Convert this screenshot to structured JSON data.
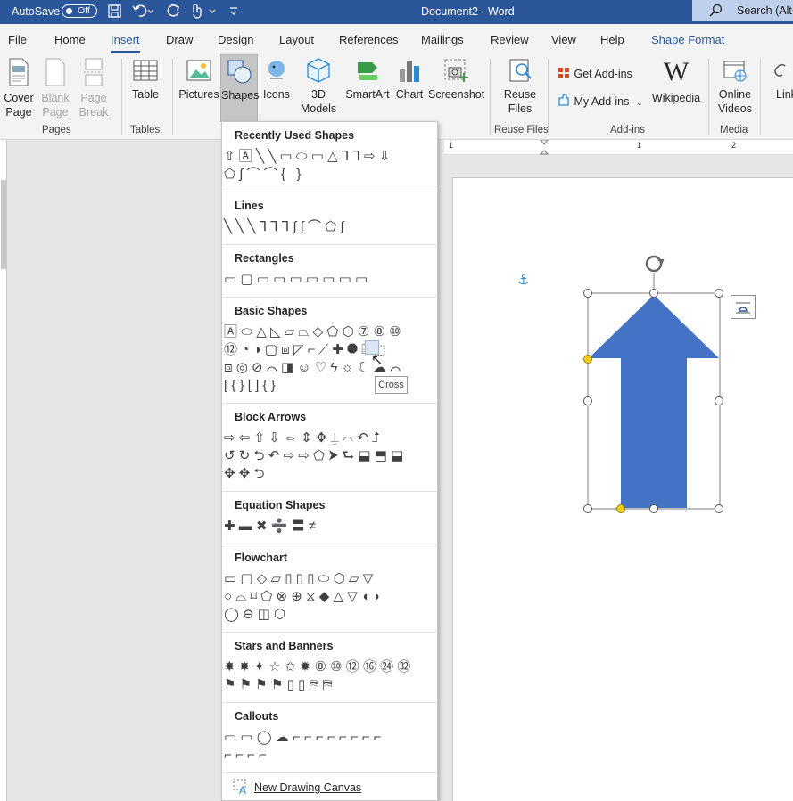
{
  "titlebar": {
    "autosave_label": "AutoSave",
    "autosave_state": "Off",
    "document_title": "Document2  -  Word",
    "search_placeholder": "Search (Alt+"
  },
  "tabs": [
    "File",
    "Home",
    "Insert",
    "Draw",
    "Design",
    "Layout",
    "References",
    "Mailings",
    "Review",
    "View",
    "Help",
    "Shape Format"
  ],
  "active_tab": "Insert",
  "ribbon": {
    "cover_page": "Cover Page",
    "blank_page": "Blank Page",
    "page_break": "Page Break",
    "table": "Table",
    "pictures": "Pictures",
    "shapes": "Shapes",
    "icons": "Icons",
    "models": "3D Models",
    "smartart": "SmartArt",
    "chart": "Chart",
    "screenshot": "Screenshot",
    "reuse_files": "Reuse Files",
    "get_addins": "Get Add-ins",
    "my_addins": "My Add-ins",
    "wikipedia": "Wikipedia",
    "online_videos": "Online Videos",
    "link": "Link",
    "groups": {
      "pages": "Pages",
      "tables": "Tables",
      "reuse_files": "Reuse Files",
      "addins": "Add-ins",
      "media": "Media"
    }
  },
  "ruler_marks": [
    "1",
    "1",
    "2"
  ],
  "shapes_menu": {
    "sections": [
      {
        "title": "Recently Used Shapes",
        "rows": [
          "⇧🄰╲╲▭⬭▭△⅂⅂⇨⇩",
          "⬠∫⌒⌒{ }"
        ]
      },
      {
        "title": "Lines",
        "rows": [
          "╲╲╲⅂⅂⅂∫∫⌒⬠∫"
        ]
      },
      {
        "title": "Rectangles",
        "rows": [
          "▭▢▭▭▭▭▭▭▭"
        ]
      },
      {
        "title": "Basic Shapes",
        "rows": [
          "🄰⬭△◺▱⏢◇⬠⬡⑦⑧⑩",
          "⑫◔◑▢⧈◸⌐⟋✚⯃⌸⬚",
          "⧈◎⊘⌒◨☺♡ϟ☼☾☁⌒",
          "[{}[]{}"
        ]
      },
      {
        "title": "Block Arrows",
        "rows": [
          "⇨⇦⇧⇩⇔⇕✥⍊⌒↶⮥",
          "↺↻⮌↶⇨⇨⬠⮞⮑⬓⬒⬓",
          "✥✥⮌"
        ]
      },
      {
        "title": "Equation Shapes",
        "rows": [
          "✚▬✖➗〓≠"
        ]
      },
      {
        "title": "Flowchart",
        "rows": [
          "▭▢◇▱▯▯▯⬭⬡▱▽",
          "○⌓⌑⬠⊗⊕⧖◆△▽◖◗",
          "◯⊖◫⬡"
        ]
      },
      {
        "title": "Stars and Banners",
        "rows": [
          "✸✸✦☆✩✹⑧⑩⑫⑯㉔㉜",
          "⚑⚑⚑⚑▯▯⛿⛿"
        ]
      },
      {
        "title": "Callouts",
        "rows": [
          "▭▭◯☁⌐⌐⌐⌐⌐⌐⌐⌐",
          "⌐⌐⌐⌐"
        ]
      }
    ],
    "new_drawing_canvas": "New Drawing Canvas"
  },
  "tooltip": "Cross",
  "colors": {
    "brand_blue": "#2b579a",
    "shape_fill": "#4472c4",
    "handle_yellow": "#f2cd1e"
  }
}
